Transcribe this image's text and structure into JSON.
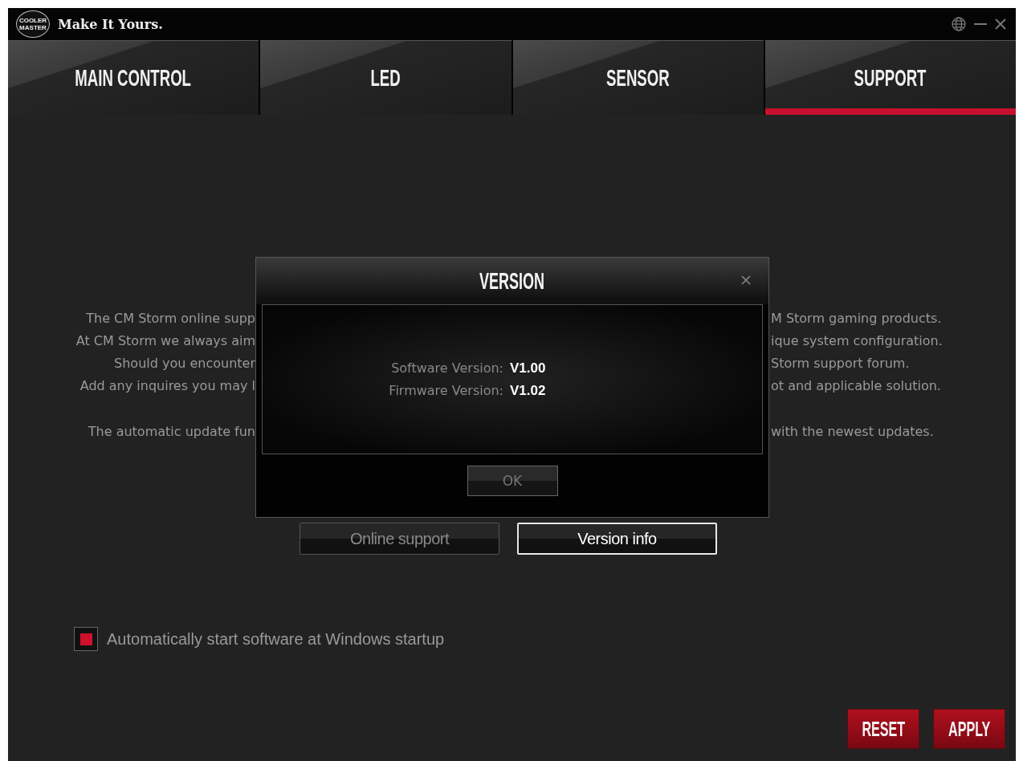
{
  "window": {
    "title": "Make It Yours.",
    "logo_lines": [
      "COOLER",
      "MASTER"
    ]
  },
  "tabs": [
    {
      "label": "MAIN CONTROL",
      "selected": false
    },
    {
      "label": "LED",
      "selected": false
    },
    {
      "label": "SENSOR",
      "selected": false
    },
    {
      "label": "SUPPORT",
      "selected": true
    }
  ],
  "support_text": {
    "paragraphs": [
      [
        {
          "left": "The CM Storm online supp",
          "right": "M Storm gaming products."
        },
        {
          "left": "At CM Storm we always aim",
          "right": "ique system configuration."
        },
        {
          "left": "Should you encounter",
          "right": "Storm support forum."
        },
        {
          "left": "Add any inquires you may l",
          "right": "ot and applicable solution."
        }
      ],
      [
        {
          "left": "The automatic update fun",
          "right": "with the newest updates."
        }
      ]
    ]
  },
  "buttons": [
    {
      "label": "Online support",
      "selected": false
    },
    {
      "label": "Version info",
      "selected": true
    }
  ],
  "autostart": {
    "label": "Automatically start software at Windows startup",
    "checked": true
  },
  "footer_buttons": [
    "RESET",
    "APPLY"
  ],
  "dialog": {
    "title": "VERSION",
    "rows": [
      {
        "label": "Software Version:",
        "value": "V1.00"
      },
      {
        "label": "Firmware Version:",
        "value": "V1.02"
      }
    ],
    "ok": "OK"
  }
}
